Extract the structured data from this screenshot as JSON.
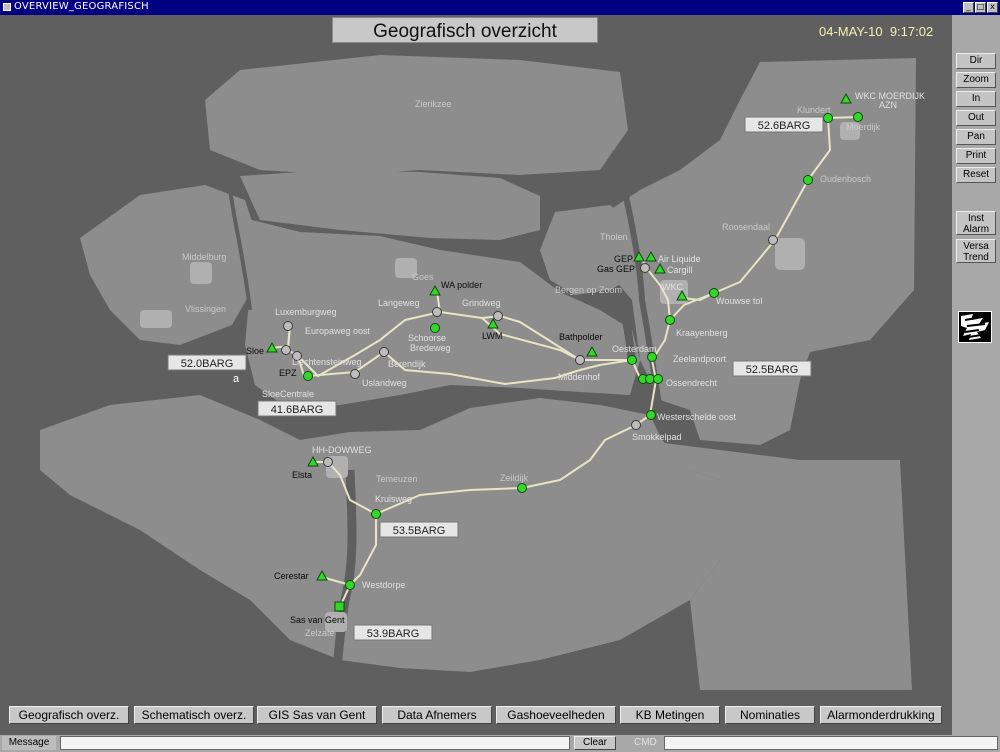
{
  "window": {
    "title": "OVERVIEW_GEOGRAFISCH",
    "min": "_",
    "max": "□",
    "close": "x"
  },
  "header": {
    "title": "Geografisch overzicht",
    "date": "04-MAY-10",
    "time": "9:17:02"
  },
  "toolbar": [
    {
      "key": "dir",
      "label": "Dir"
    },
    {
      "key": "zoom",
      "label": "Zoom"
    },
    {
      "key": "in",
      "label": "In"
    },
    {
      "key": "out",
      "label": "Out"
    },
    {
      "key": "pan",
      "label": "Pan"
    },
    {
      "key": "print",
      "label": "Print"
    },
    {
      "key": "reset",
      "label": "Reset"
    },
    {
      "key": "inst-alarm",
      "label": "Inst Alarm"
    },
    {
      "key": "versa-trend",
      "label": "Versa Trend"
    }
  ],
  "map": {
    "place_labels": {
      "zierikzee": "Zierikzee",
      "middelburg": "Middelburg",
      "vlissingen": "Vlissingen",
      "goes": "Goes",
      "tholen": "Tholen",
      "roosendaal": "Roosendaal",
      "klundert": "Klundert",
      "moerdijk": "Moerdijk",
      "oudenbosch": "Oudenbosch",
      "bergen_op_zoom": "Bergen op Zoom",
      "temeuzen": "Temeuzen",
      "zeildijk": "Zeildijk",
      "zelzate": "Zelzate"
    },
    "stations": {
      "wkc_moerdijk_l1": "WKC MOERDIJK",
      "wkc_moerdijk_l2": "AZN",
      "gep": "GEP",
      "air_liquide": "Air Liquide",
      "gas_gep": "Gas GEP",
      "cargill": "Cargill",
      "wkc": "WKC",
      "wouwse_tol": "Wouwse tol",
      "kraayenberg": "Kraayenberg",
      "oesterdam": "Oesterdam",
      "zeelandpoort": "Zeelandpoort",
      "ossendrecht": "Ossendrecht",
      "westerschelde_oost": "Westerschelde oost",
      "smokkelpad": "Smokkelpad",
      "bathpolder": "Bathpolder",
      "middenhof": "Middenhof",
      "wa_polder": "WA polder",
      "langeweg": "Langeweg",
      "grindweg": "Grindweg",
      "lwm": "LWM",
      "schoorse_bredeweg_l1": "Schoorse",
      "schoorse_bredeweg_l2": "Bredeweg",
      "luxemburgweg": "Luxemburgweg",
      "europaweg_oost": "Europaweg oost",
      "sloe": "Sloe",
      "liechtensteinweg": "Liechtensteinweg",
      "epz": "EPZ",
      "sloecentrale": "SloeCentrale",
      "uslandweg": "Uslandweg",
      "berendijk": "Berendijk",
      "hh_dowweg": "HH-DOWWEG",
      "elsta": "Elsta",
      "kruisweg": "Kruisweg",
      "cerestar": "Cerestar",
      "westdorpe": "Westdorpe",
      "sas_van_gent": "Sas van Gent"
    },
    "pressures": {
      "moerdijk": "52.6BARG",
      "sloe": "52.0BARG",
      "sloecentrale": "41.6BARG",
      "ossendrecht": "52.5BARG",
      "kruisweg": "53.5BARG",
      "sas_van_gent": "53.9BARG"
    },
    "marker_a": "a"
  },
  "nav": [
    {
      "key": "geografisch",
      "label": "Geografisch overz."
    },
    {
      "key": "schematisch",
      "label": "Schematisch overz."
    },
    {
      "key": "gis",
      "label": "GIS Sas van Gent"
    },
    {
      "key": "afnemers",
      "label": "Data Afnemers"
    },
    {
      "key": "gashoeveelheden",
      "label": "Gashoeveelheden"
    },
    {
      "key": "kb",
      "label": "KB Metingen"
    },
    {
      "key": "nominaties",
      "label": "Nominaties"
    },
    {
      "key": "alarmonderdrukking",
      "label": "Alarmonderdrukking"
    }
  ],
  "statusbar": {
    "message_label": "Message",
    "clear_label": "Clear",
    "cmd_label": "CMD"
  },
  "colors": {
    "land": "#8c8c8c",
    "sea": "#5f5f5f",
    "pipe": "#e8e4c4",
    "node_active": "#35d62a",
    "node_inactive": "#bdbdbd"
  }
}
